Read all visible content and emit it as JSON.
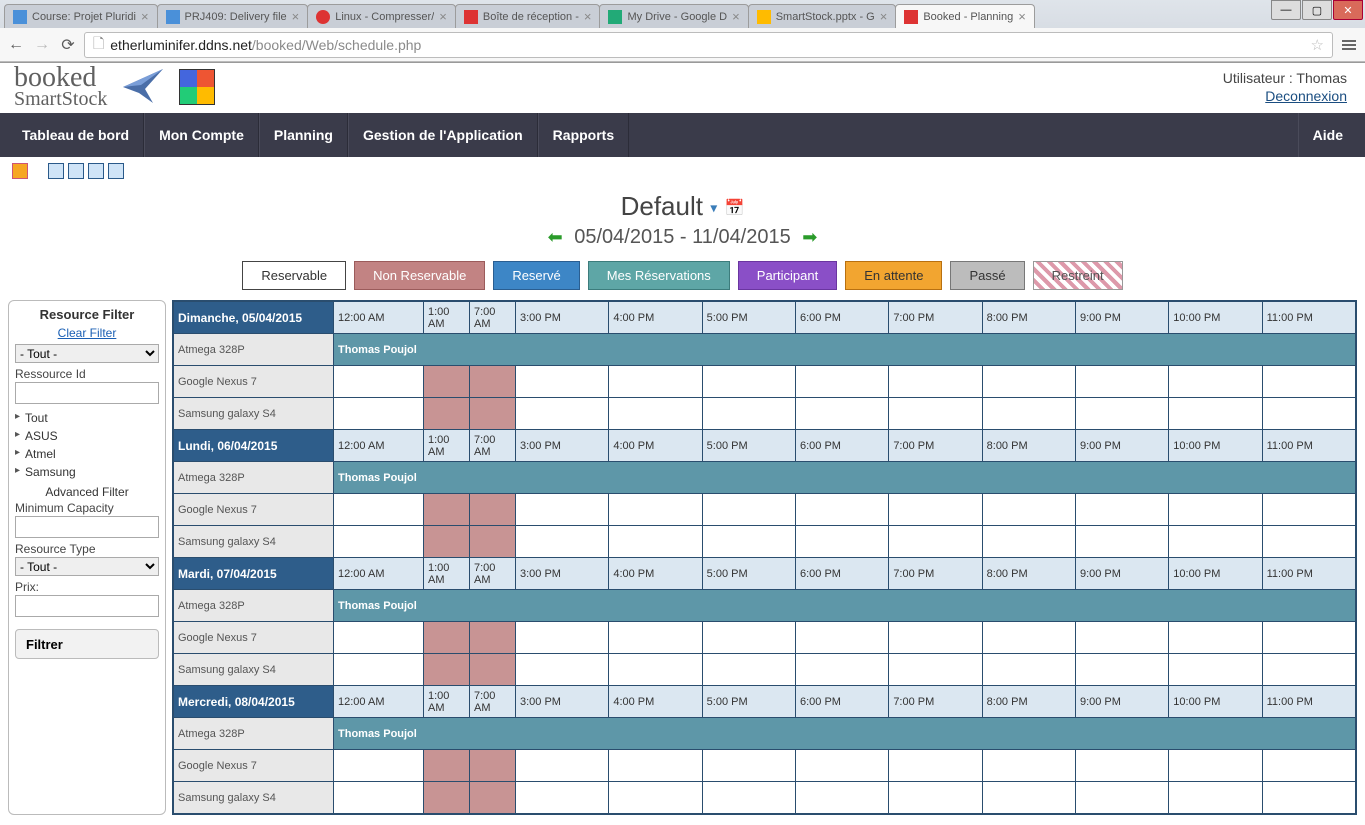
{
  "browser": {
    "tabs": [
      {
        "title": "Course: Projet Pluridi"
      },
      {
        "title": "PRJ409: Delivery file"
      },
      {
        "title": "Linux - Compresser/"
      },
      {
        "title": "Boîte de réception -"
      },
      {
        "title": "My Drive - Google D"
      },
      {
        "title": "SmartStock.pptx - G"
      },
      {
        "title": "Booked - Planning"
      }
    ],
    "url_host": "etherluminifer.ddns.net",
    "url_path": "/booked/Web/schedule.php"
  },
  "user": {
    "label": "Utilisateur : Thomas",
    "logout": "Deconnexion"
  },
  "nav": {
    "dashboard": "Tableau de bord",
    "account": "Mon Compte",
    "planning": "Planning",
    "admin": "Gestion de l'Application",
    "reports": "Rapports",
    "help": "Aide"
  },
  "title": {
    "name": "Default",
    "range": "05/04/2015 - 11/04/2015"
  },
  "legend": {
    "reservable": "Reservable",
    "nonres": "Non Reservable",
    "reserve": "Reservé",
    "myres": "Mes Réservations",
    "participant": "Participant",
    "attente": "En attente",
    "passe": "Passé",
    "restreint": "Restreint"
  },
  "filter": {
    "heading": "Resource Filter",
    "clear": "Clear Filter",
    "all": "- Tout -",
    "resid_label": "Ressource Id",
    "tree": [
      "Tout",
      "ASUS",
      "Atmel",
      "Samsung"
    ],
    "advanced": "Advanced Filter",
    "mincap": "Minimum Capacity",
    "restype": "Resource Type",
    "price": "Prix:",
    "button": "Filtrer"
  },
  "times": [
    "12:00 AM",
    "1:00 AM",
    "7:00 AM",
    "3:00 PM",
    "4:00 PM",
    "5:00 PM",
    "6:00 PM",
    "7:00 PM",
    "8:00 PM",
    "9:00 PM",
    "10:00 PM",
    "11:00 PM"
  ],
  "days": [
    {
      "label": "Dimanche, 05/04/2015"
    },
    {
      "label": "Lundi, 06/04/2015"
    },
    {
      "label": "Mardi, 07/04/2015"
    },
    {
      "label": "Mercredi, 08/04/2015"
    }
  ],
  "resources": [
    "Atmega 328P",
    "Google Nexus 7",
    "Samsung galaxy S4"
  ],
  "reservation_owner": "Thomas Poujol"
}
